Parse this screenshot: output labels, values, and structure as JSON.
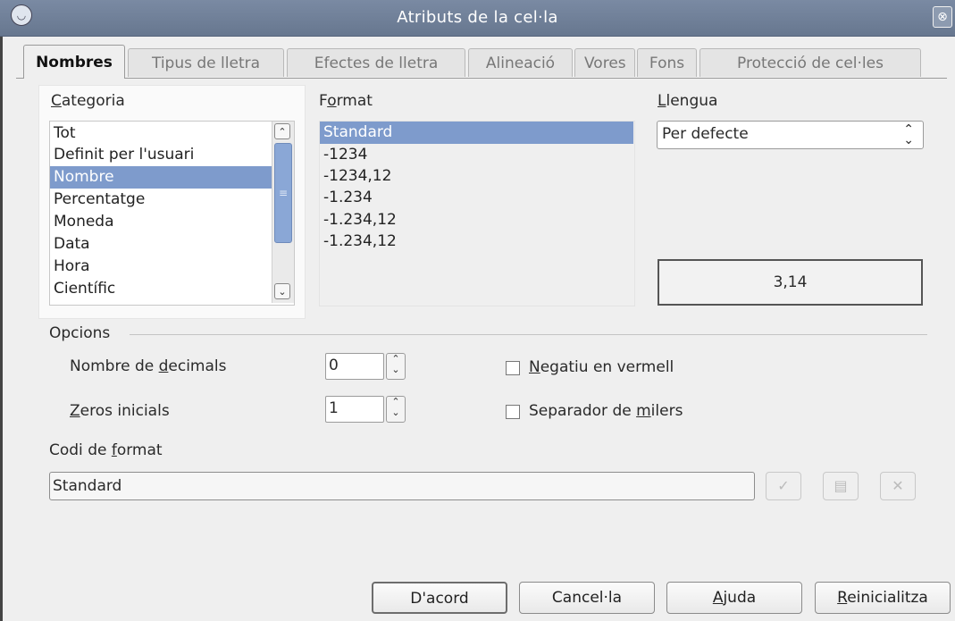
{
  "window": {
    "title": "Atributs de la cel·la",
    "close_symbol": "⊗"
  },
  "tabs": [
    {
      "label": "Nombres",
      "active": true
    },
    {
      "label": "Tipus de lletra",
      "active": false
    },
    {
      "label": "Efectes de lletra",
      "active": false
    },
    {
      "label": "Alineació",
      "active": false
    },
    {
      "label": "Vores",
      "active": false
    },
    {
      "label": "Fons",
      "active": false
    },
    {
      "label": "Protecció de cel·les",
      "active": false
    }
  ],
  "category": {
    "label_mnemonic": "C",
    "label_rest": "ategoria",
    "items": [
      "Tot",
      "Definit per l'usuari",
      "Nombre",
      "Percentatge",
      "Moneda",
      "Data",
      "Hora",
      "Científic"
    ],
    "selected": "Nombre"
  },
  "format": {
    "label_pre": "F",
    "label_mnemonic": "o",
    "label_rest": "rmat",
    "items": [
      "Standard",
      "-1234",
      "-1234,12",
      "-1.234",
      "-1.234,12",
      "-1.234,12"
    ],
    "selected": "Standard"
  },
  "language": {
    "label_mnemonic": "L",
    "label_rest": "lengua",
    "value": "Per defecte"
  },
  "preview": {
    "value": "3,14"
  },
  "options": {
    "title": "Opcions",
    "decimals": {
      "label_pre": "Nombre de ",
      "label_mnemonic": "d",
      "label_rest": "ecimals",
      "value": "0"
    },
    "leading_zeros": {
      "label_mnemonic": "Z",
      "label_rest": "eros inicials",
      "value": "1"
    },
    "negative_red": {
      "label_mnemonic": "N",
      "label_rest": "egatiu en vermell",
      "checked": false
    },
    "thousands_sep": {
      "label_pre": "Separador de ",
      "label_mnemonic": "m",
      "label_rest": "ilers",
      "checked": false
    }
  },
  "format_code": {
    "label_pre": "Codi de ",
    "label_mnemonic": "f",
    "label_rest": "ormat",
    "value": "Standard"
  },
  "buttons": {
    "ok": "D'acord",
    "cancel": "Cancel·la",
    "help_mnemonic": "A",
    "help_rest": "juda",
    "reset_mnemonic": "R",
    "reset_rest": "einicialitza"
  },
  "icons": {
    "title_icon": "app-icon",
    "accept_icon": "checkmark-icon",
    "edit_icon": "edit-comment-icon",
    "delete_icon": "x-delete-icon"
  }
}
